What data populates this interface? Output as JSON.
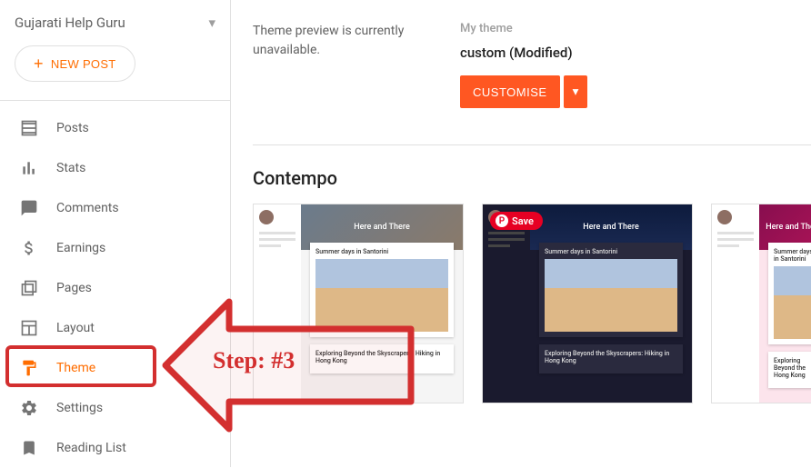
{
  "blog": {
    "name": "Gujarati Help Guru"
  },
  "newPost": {
    "label": "NEW POST"
  },
  "nav": {
    "items": [
      {
        "label": "Posts"
      },
      {
        "label": "Stats"
      },
      {
        "label": "Comments"
      },
      {
        "label": "Earnings"
      },
      {
        "label": "Pages"
      },
      {
        "label": "Layout"
      },
      {
        "label": "Theme"
      },
      {
        "label": "Settings"
      },
      {
        "label": "Reading List"
      }
    ]
  },
  "theme": {
    "previewMsg": "Theme preview is currently unavailable.",
    "myThemeLabel": "My theme",
    "currentName": "custom (Modified)",
    "customiseLabel": "CUSTOMISE"
  },
  "gallery": {
    "sectionTitle": "Contempo",
    "cards": [
      {
        "heroTitle": "Here and There",
        "postTitle": "Summer days in Santorini",
        "post2Title": "Exploring Beyond the Skyscrapers: Hiking in Hong Kong"
      },
      {
        "heroTitle": "Here and There",
        "postTitle": "Summer days in Santorini",
        "post2Title": "Exploring Beyond the Skyscrapers: Hiking in Hong Kong",
        "pinLabel": "Save"
      },
      {
        "heroTitle": "Here and There",
        "postTitle": "Summer days in Santorini",
        "post2Title": "Exploring Beyond the Hong Kong"
      }
    ]
  },
  "annotation": {
    "stepText": "Step: #3"
  }
}
